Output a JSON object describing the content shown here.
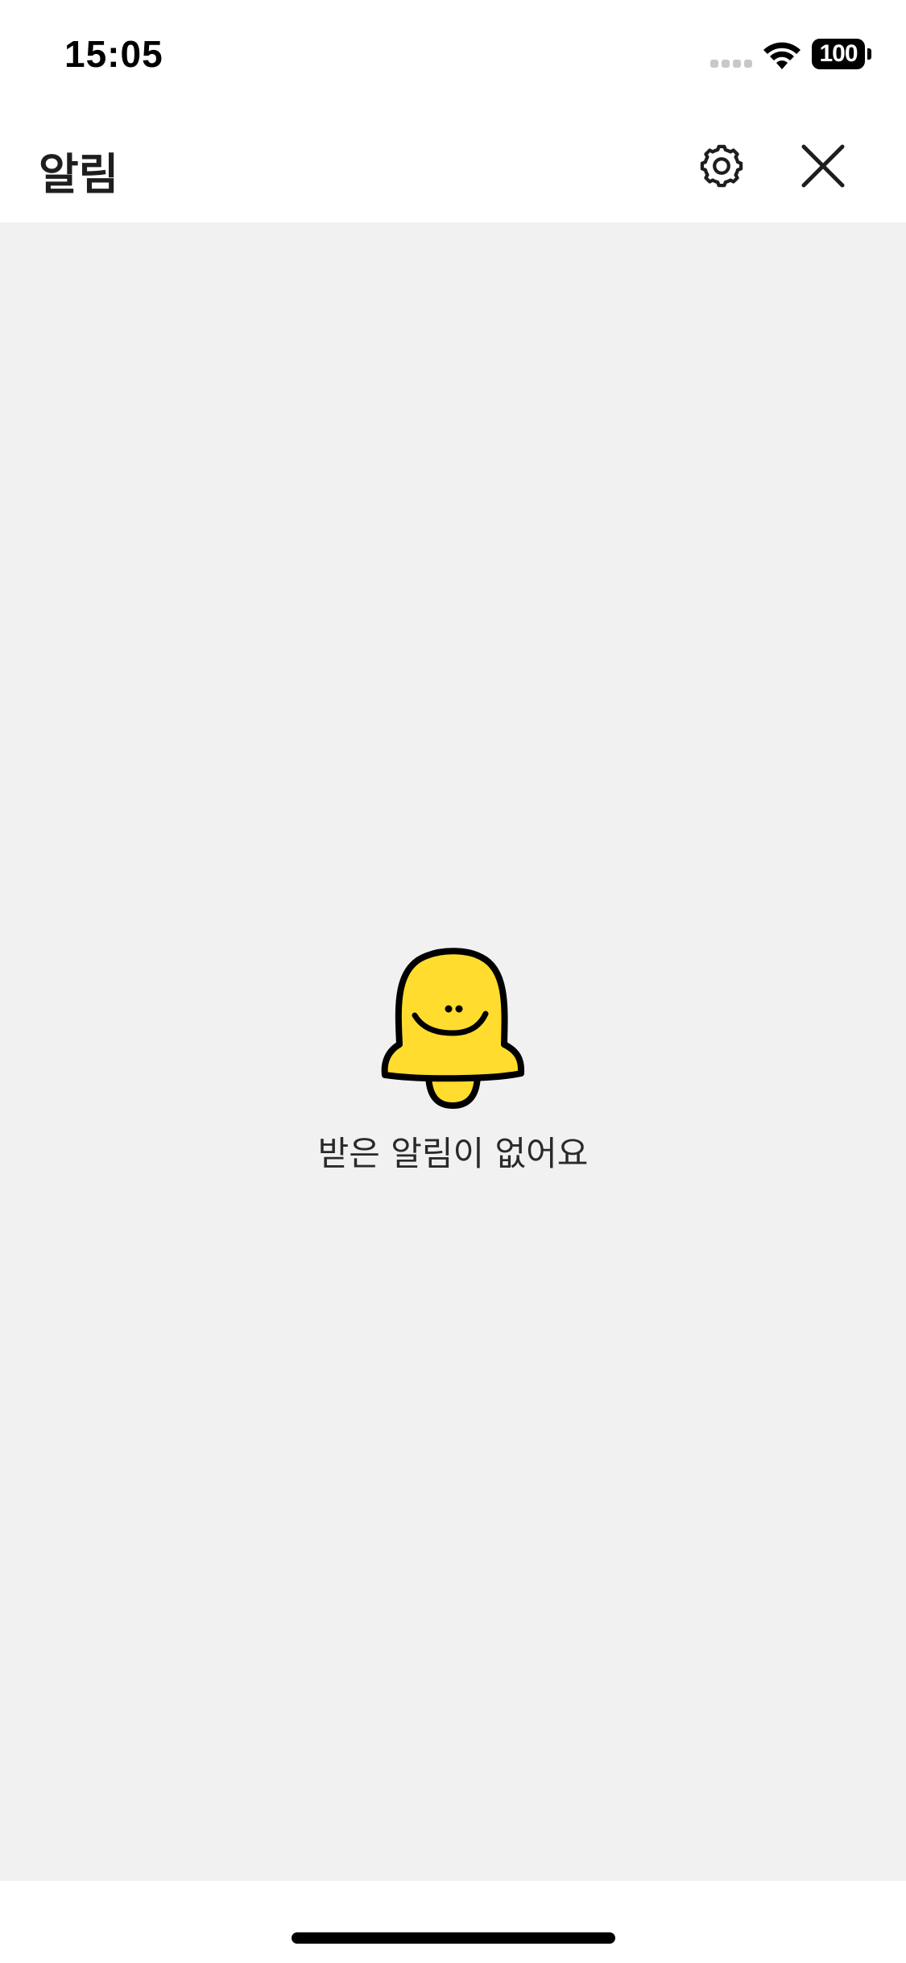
{
  "status_bar": {
    "time": "15:05",
    "battery_level": "100",
    "icons": [
      "signal-icon",
      "wifi-icon",
      "battery-icon"
    ]
  },
  "header": {
    "title": "알림",
    "settings_icon": "gear-icon",
    "close_icon": "close-icon"
  },
  "empty_state": {
    "illustration": "smiling-bell-icon",
    "message": "받은 알림이 없어요"
  },
  "colors": {
    "bell_yellow": "#FFDC2E",
    "content_background": "#F1F1F1",
    "outline": "#000000"
  }
}
